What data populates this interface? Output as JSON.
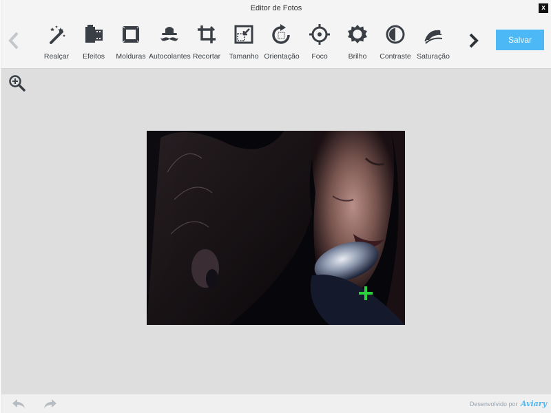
{
  "window": {
    "title": "Editor de Fotos",
    "close_label": "x"
  },
  "toolbar": {
    "prev_icon": "chevron-left-icon",
    "next_icon": "chevron-right-icon",
    "tools": [
      {
        "label": "Realçar",
        "icon": "magic-wand-icon"
      },
      {
        "label": "Efeitos",
        "icon": "film-icon"
      },
      {
        "label": "Molduras",
        "icon": "frame-icon"
      },
      {
        "label": "Autocolantes",
        "icon": "mustache-icon"
      },
      {
        "label": "Recortar",
        "icon": "crop-icon"
      },
      {
        "label": "Tamanho",
        "icon": "resize-icon"
      },
      {
        "label": "Orientação",
        "icon": "rotate-icon"
      },
      {
        "label": "Foco",
        "icon": "focus-icon"
      },
      {
        "label": "Brilho",
        "icon": "brightness-icon"
      },
      {
        "label": "Contraste",
        "icon": "contrast-icon"
      },
      {
        "label": "Saturação",
        "icon": "saturation-icon"
      }
    ],
    "save_label": "Salvar"
  },
  "canvas": {
    "zoom_icon": "zoom-in-icon"
  },
  "footer": {
    "undo_icon": "undo-icon",
    "redo_icon": "redo-icon",
    "powered_by": "Desenvolvido por",
    "brand": "Aviary"
  },
  "colors": {
    "accent": "#4cb8f5",
    "toolbar_bg": "#f4f4f4",
    "canvas_bg": "#dedede",
    "icon": "#3a3f45"
  }
}
